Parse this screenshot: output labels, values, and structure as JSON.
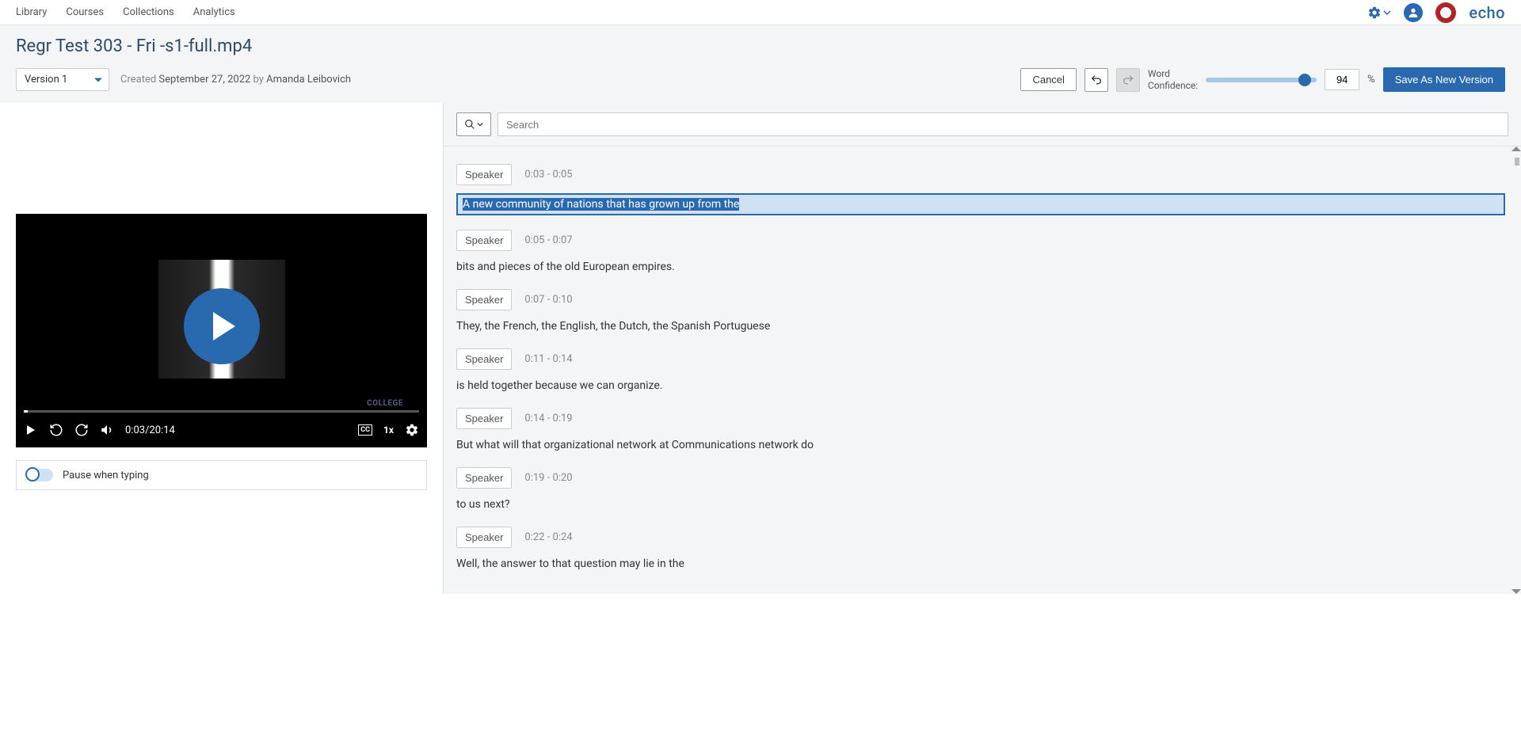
{
  "nav": {
    "items": [
      "Library",
      "Courses",
      "Collections",
      "Analytics"
    ],
    "logo": "echo"
  },
  "page": {
    "title": "Regr Test 303 - Fri -s1-full.mp4",
    "version_label": "Version 1",
    "created_prefix": "Created ",
    "created_date": "September 27, 2022",
    "created_by": " by ",
    "created_author": "Amanda Leibovich",
    "cancel": "Cancel",
    "wc_label1": "Word",
    "wc_label2": "Confidence:",
    "wc_value": "94",
    "pct": "%",
    "save": "Save As New Version"
  },
  "video": {
    "time": "0:03/20:14",
    "speed": "1x",
    "cc": "CC",
    "watermark": "COLLEGE"
  },
  "toggle": {
    "label": "Pause when typing"
  },
  "search": {
    "placeholder": "Search"
  },
  "segments": [
    {
      "speaker": "Speaker",
      "time": "0:03 - 0:05",
      "text": "A new community of nations that has grown up from the",
      "active": true
    },
    {
      "speaker": "Speaker",
      "time": "0:05 - 0:07",
      "text": "bits and pieces of the old European empires."
    },
    {
      "speaker": "Speaker",
      "time": "0:07 - 0:10",
      "text": "They, the French, the English, the Dutch, the Spanish Portuguese"
    },
    {
      "speaker": "Speaker",
      "time": "0:11 - 0:14",
      "text": "is held together because we can organize."
    },
    {
      "speaker": "Speaker",
      "time": "0:14 - 0:19",
      "text": "But what will that organizational network at Communications network do"
    },
    {
      "speaker": "Speaker",
      "time": "0:19 - 0:20",
      "text": "to us next?"
    },
    {
      "speaker": "Speaker",
      "time": "0:22 - 0:24",
      "text": "Well, the answer to that question may lie in the"
    }
  ]
}
